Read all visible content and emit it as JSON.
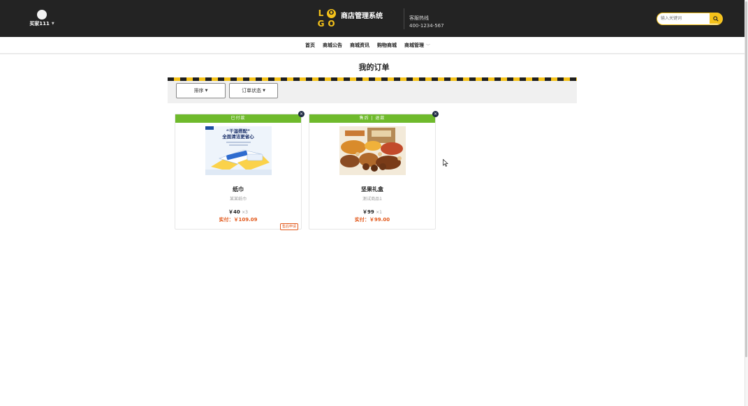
{
  "header": {
    "username": "买家111",
    "logo_letters": [
      "L",
      "O",
      "G",
      "O"
    ],
    "site_title": "商店管理系统",
    "hotline_label": "客服热线",
    "hotline_number": "400-1234-567",
    "search_placeholder": "输入关键词",
    "search_icon": "search-icon"
  },
  "nav": {
    "items": [
      {
        "label": "首页"
      },
      {
        "label": "商城公告"
      },
      {
        "label": "商城资讯"
      },
      {
        "label": "购物商城"
      },
      {
        "label": "商城管理"
      }
    ]
  },
  "page": {
    "title": "我的订单"
  },
  "filters": {
    "sort_label": "排序",
    "status_label": "订单状态"
  },
  "orders": [
    {
      "status": "已付款",
      "image": "tissue-product-image",
      "image_text_1": "“干湿搭配”",
      "image_text_2": "全面清洁更省心",
      "name": "纸巾",
      "subtitle": "某某纸巾",
      "price": "￥40",
      "qty": "×3",
      "paid": "实付：￥109.09",
      "action": "售后申请"
    },
    {
      "status": "售后 | 退款",
      "image": "nut-gift-box-image",
      "name": "坚果礼盒",
      "subtitle": "测试商品1",
      "price": "￥99",
      "qty": "×1",
      "paid": "实付：￥99.00"
    }
  ],
  "colors": {
    "header_bg": "#232323",
    "accent": "#f5c21a",
    "status_green": "#6fba2c",
    "price_orange": "#e2591c"
  }
}
